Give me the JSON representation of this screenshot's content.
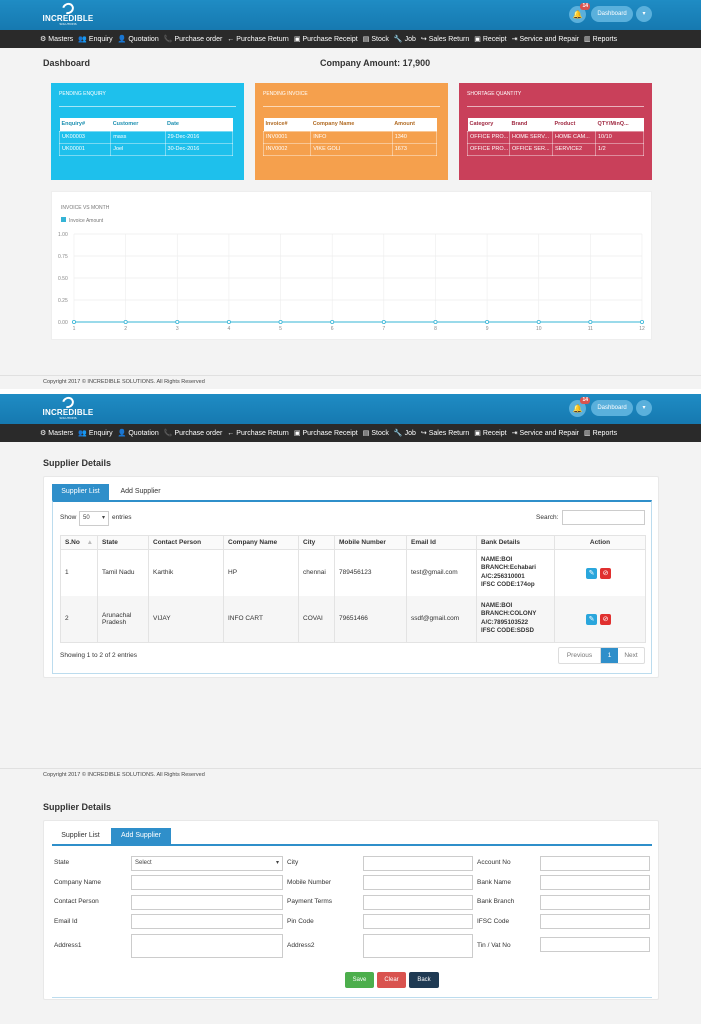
{
  "brand": {
    "name": "INCREDIBLE",
    "sub": "SOLUTIONS"
  },
  "header": {
    "notif_count": "14",
    "dashboard_label": "Dashboard",
    "caret": "▾",
    "bell": "🔔"
  },
  "nav": [
    {
      "icon": "⚙",
      "label": "Masters"
    },
    {
      "icon": "👥",
      "label": "Enquiry"
    },
    {
      "icon": "👤",
      "label": "Quotation"
    },
    {
      "icon": "📞",
      "label": "Purchase order"
    },
    {
      "icon": "←",
      "label": "Purchase Return"
    },
    {
      "icon": "▣",
      "label": "Purchase Receipt"
    },
    {
      "icon": "▤",
      "label": "Stock"
    },
    {
      "icon": "🔧",
      "label": "Job"
    },
    {
      "icon": "↪",
      "label": "Sales Return"
    },
    {
      "icon": "▣",
      "label": "Receipt"
    },
    {
      "icon": "⇥",
      "label": "Service and Repair"
    },
    {
      "icon": "▥",
      "label": "Reports"
    }
  ],
  "dashboard": {
    "title": "Dashboard",
    "company_amount": "Company Amount: 17,900",
    "enquiry": {
      "title": "PENDING ENQUIRY",
      "headers": [
        "Enquiry#",
        "Customer",
        "Date"
      ],
      "rows": [
        [
          "UK00003",
          "mass",
          "29-Dec-2016"
        ],
        [
          "UK00001",
          "Joel",
          "30-Dec-2016"
        ]
      ]
    },
    "invoice": {
      "title": "PENDING INVOICE",
      "headers": [
        "Invoice#",
        "Company Name",
        "Amount"
      ],
      "rows": [
        [
          "INV0001",
          "INFO",
          "1340"
        ],
        [
          "INV0002",
          "VIKE GOLI",
          "1673"
        ]
      ]
    },
    "shortage": {
      "title": "SHORTAGE QUANTITY",
      "headers": [
        "Category",
        "Brand",
        "Product",
        "QTY/MinQ..."
      ],
      "rows": [
        [
          "OFFICE PRO...",
          "HOME SERV...",
          "HOME CAM...",
          "10/10"
        ],
        [
          "OFFICE PRO...",
          "OFFICE SER...",
          "SERVICE2",
          "1/2"
        ]
      ]
    }
  },
  "chart_data": {
    "type": "line",
    "title": "INVOICE VS MONTH",
    "series": [
      {
        "name": "Invoice Amount",
        "values": [
          0,
          0,
          0,
          0,
          0,
          0,
          0,
          0,
          0,
          0,
          0,
          0
        ]
      }
    ],
    "x": [
      1,
      2,
      3,
      4,
      5,
      6,
      7,
      8,
      9,
      10,
      11,
      12
    ],
    "ylim": [
      0,
      1
    ],
    "yticks": [
      "0.00",
      "0.25",
      "0.50",
      "0.75",
      "1.00"
    ],
    "grid": true,
    "legend": "top-left",
    "color": "#35b4d6"
  },
  "footer": {
    "text": "Copyright 2017 © INCREDIBLE SOLUTIONS. All Rights Reserved"
  },
  "supplier_list": {
    "title": "Supplier Details",
    "tabs": [
      "Supplier List",
      "Add Supplier"
    ],
    "show_label": "Show",
    "show_value": "50",
    "entries_label": "entries",
    "search_label": "Search:",
    "headers": [
      "S.No",
      "State",
      "Contact Person",
      "Company Name",
      "City",
      "Mobile Number",
      "Email Id",
      "Bank Details",
      "Action"
    ],
    "sort_mark": "▲",
    "rows": [
      {
        "sno": "1",
        "state": "Tamil Nadu",
        "contact": "Karthik",
        "company": "HP",
        "city": "chennai",
        "mobile": "789456123",
        "email": "test@gmail.com",
        "bank": [
          "NAME:BOI",
          "BRANCH:Echabari",
          "A/C:256310001",
          "IFSC CODE:174op"
        ]
      },
      {
        "sno": "2",
        "state": "Arunachal Pradesh",
        "contact": "VIJAY",
        "company": "INFO CART",
        "city": "COVAI",
        "mobile": "79651466",
        "email": "ssdf@gmail.com",
        "bank": [
          "NAME:BOI",
          "BRANCH:COLONY",
          "A/C:7895103522",
          "IFSC CODE:SDSD"
        ]
      }
    ],
    "info": "Showing 1 to 2 of 2 entries",
    "pagination": [
      "Previous",
      "1",
      "Next"
    ],
    "edit_icon": "✎",
    "delete_icon": "⊘"
  },
  "add_supplier": {
    "title": "Supplier Details",
    "tabs": [
      "Supplier List",
      "Add Supplier"
    ],
    "fields": {
      "state": "State",
      "state_value": "Select",
      "city": "City",
      "account_no": "Account No",
      "company_name": "Company Name",
      "mobile_number": "Mobile Number",
      "bank_name": "Bank Name",
      "contact_person": "Contact Person",
      "payment_terms": "Payment Terms",
      "bank_branch": "Bank Branch",
      "email_id": "Email Id",
      "pin_code": "Pin Code",
      "ifsc_code": "IFSC Code",
      "address1": "Address1",
      "address2": "Address2",
      "tin_vat": "Tin / Vat No"
    },
    "buttons": {
      "save": "Save",
      "clear": "Clear",
      "back": "Back"
    },
    "colors": {
      "save": "#4cae4c",
      "clear": "#d9534f",
      "back": "#1f3a53"
    }
  }
}
